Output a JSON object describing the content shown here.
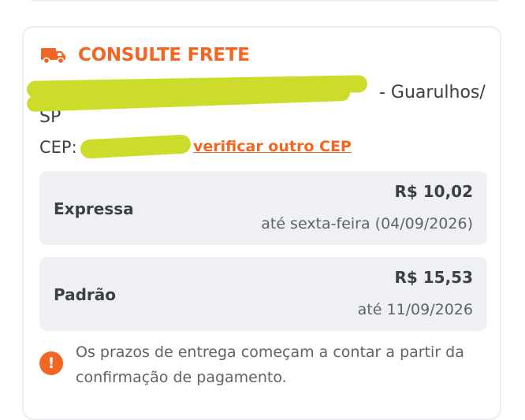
{
  "shipping": {
    "title": "CONSULTE FRETE",
    "address_visible": "- Guarulhos/",
    "address_line2": "SP",
    "cep_label": "CEP:",
    "cep_link": "verificar outro CEP"
  },
  "options": [
    {
      "name": "Expressa",
      "price": "R$ 10,02",
      "date": "até sexta-feira (04/09/2026)"
    },
    {
      "name": "Padrão",
      "price": "R$ 15,53",
      "date": "até 11/09/2026"
    }
  ],
  "notice": {
    "icon": "!",
    "text": "Os prazos de entrega começam a contar a partir da confirmação de pagamento."
  },
  "colors": {
    "accent": "#f26522",
    "redaction": "#cddc2a",
    "option_bg": "#eef0f3"
  },
  "icons": {
    "header": "truck-icon",
    "notice": "warning-icon"
  }
}
